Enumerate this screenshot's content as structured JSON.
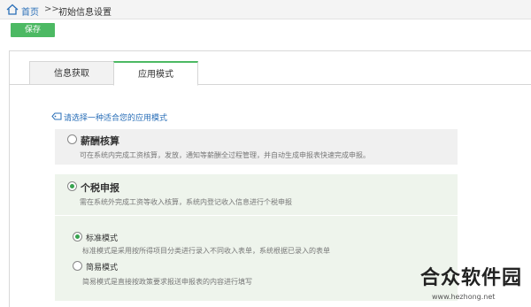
{
  "breadcrumb": {
    "home": "首页",
    "separator": ">>",
    "current": "初始信息设置"
  },
  "toolbar": {
    "save_label": "保存"
  },
  "tabs": [
    {
      "label": "信息获取",
      "active": false
    },
    {
      "label": "应用模式",
      "active": true
    }
  ],
  "prompt": "请选择一种适合您的应用模式",
  "options": {
    "salary": {
      "title": "薪酬核算",
      "checked": false,
      "desc": "可在系统内完成工资核算，发放，通知等薪酬全过程管理，并自动生成申报表快速完成申报。"
    },
    "tax": {
      "title": "个税申报",
      "checked": true,
      "desc": "需在系统外完成工资等收入核算，系统内登记收入信息进行个税申报",
      "modes": [
        {
          "title": "标准模式",
          "checked": true,
          "desc": "标准模式是采用按所得项目分类进行录入不同收入表单，系统根据已录入的表单"
        },
        {
          "title": "简易模式",
          "checked": false,
          "desc": "简易模式是直接按政策要求报送申报表的内容进行填写"
        }
      ]
    }
  },
  "watermark": {
    "text": "合众软件园",
    "url": "www.hezhong.net"
  },
  "colors": {
    "accent": "#4cb963",
    "link": "#2a6fb8",
    "selected_bg": "#eef4ec"
  }
}
